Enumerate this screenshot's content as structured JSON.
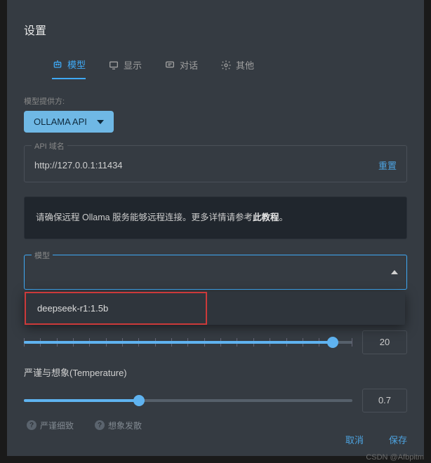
{
  "title": "设置",
  "tabs": {
    "model": "模型",
    "display": "显示",
    "conversation": "对话",
    "other": "其他"
  },
  "provider": {
    "label": "模型提供方:",
    "value": "OLLAMA API"
  },
  "api": {
    "legend": "API 域名",
    "value": "http://127.0.0.1:11434",
    "reset": "重置"
  },
  "notice": {
    "prefix": "请确保远程 Ollama 服务能够远程连接。更多详情请参考",
    "link": "此教程",
    "suffix": "。"
  },
  "model_select": {
    "legend": "模型",
    "options": [
      "deepseek-r1:1.5b"
    ]
  },
  "slider1": {
    "value": "20",
    "fill_pct": 94
  },
  "temperature": {
    "label": "严谨与想象(Temperature)",
    "value": "0.7",
    "fill_pct": 35,
    "hint_low": "严谨细致",
    "hint_high": "想象发散"
  },
  "footer": {
    "cancel": "取消",
    "save": "保存"
  },
  "watermark": "CSDN @Afbpitm"
}
